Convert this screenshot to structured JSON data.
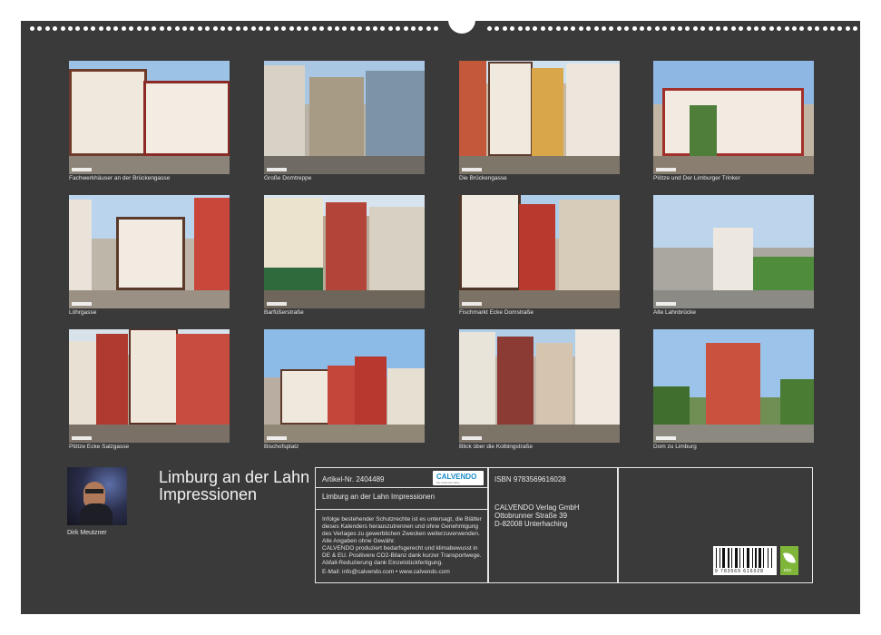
{
  "calendar": {
    "title": "Limburg an der Lahn Impressionen",
    "author": "Dirk Meutzner"
  },
  "photos": [
    {
      "caption": "Fachwerkhäuser an der Brückengasse"
    },
    {
      "caption": "Große Domtreppe"
    },
    {
      "caption": "Die Brückengasse"
    },
    {
      "caption": "Plötze und Der Limburger Trinker"
    },
    {
      "caption": "Löhrgasse"
    },
    {
      "caption": "Barfüßerstraße"
    },
    {
      "caption": "Fischmarkt Ecke Domstraße"
    },
    {
      "caption": "Alte Lahnbrücke"
    },
    {
      "caption": "Plötze Ecke Salzgasse"
    },
    {
      "caption": "Bischofsplatz"
    },
    {
      "caption": "Blick über die Kolbingstraße"
    },
    {
      "caption": "Dom zu Limburg"
    }
  ],
  "info": {
    "article": "Artikel-Nr. 2404489",
    "logo": "CALVENDO",
    "logo_sub": "Die Kalendermarke",
    "title": "Limburg an der Lahn Impressionen",
    "legal1": "Infolge bestehender Schutzrechte ist es untersagt, die Blätter dieses Kalenders herauszutrennen und ohne Genehmigung des Verlages zu gewerblichen Zwecken weiterzuverwenden. Alle Angaben ohne Gewähr.",
    "legal2": "CALVENDO produziert bedarfsgerecht und klimabewusst in DE & EU. Positivere CO2-Bilanz dank kurzer Transportwege. Abfall-Reduzierung dank Einzelstückfertigung.",
    "contact": "E-Mail: info@calvendo.com • www.calvendo.com",
    "isbn": "ISBN 9783569616028",
    "publisher": "CALVENDO Verlag GmbH",
    "street": "Ottobrunner Straße 39",
    "city": "D-82008 Unterhaching",
    "barcode_digits": "9 783569 616028",
    "eco_label": "eco"
  },
  "colors": {
    "background": "#3a3a3a",
    "frame": "#e6e6e6",
    "brand": "#1a8bc6",
    "eco": "#7fb539"
  }
}
